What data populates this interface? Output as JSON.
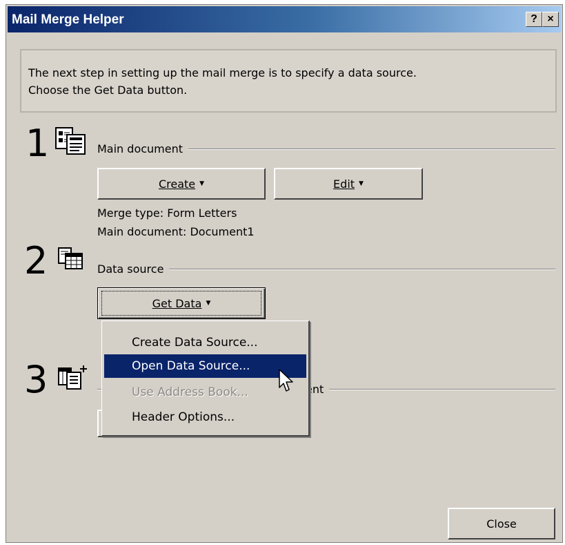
{
  "window": {
    "title": "Mail Merge Helper",
    "help_button": "?",
    "close_button": "×"
  },
  "instructions": {
    "line1": "The next step in setting up the mail merge is to specify a data source.",
    "line2": "Choose the Get Data button."
  },
  "step1": {
    "number": "1",
    "label": "Main document",
    "create_button": "Create",
    "edit_button": "Edit",
    "merge_type": "Merge type: Form Letters",
    "main_document": "Main document: Document1"
  },
  "step2": {
    "number": "2",
    "label": "Data source",
    "get_data_button": "Get Data"
  },
  "step3": {
    "number": "3",
    "label_tail": "ent"
  },
  "menu": {
    "items": [
      {
        "label": "Create Data Source..."
      },
      {
        "label": "Open Data Source..."
      },
      {
        "label": "Use Address Book..."
      },
      {
        "label": "Header Options..."
      }
    ]
  },
  "footer": {
    "close_button": "Close"
  }
}
